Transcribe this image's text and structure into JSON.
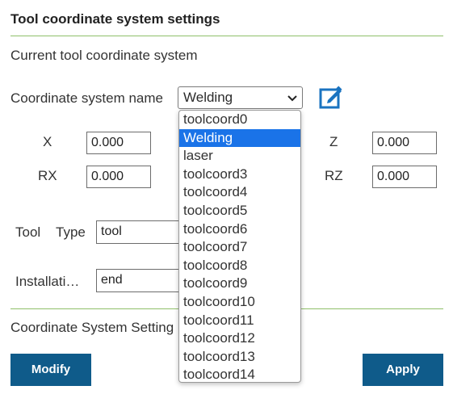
{
  "panel": {
    "title": "Tool coordinate system settings",
    "subtitle": "Current tool coordinate system",
    "coord_name_label": "Coordinate system name",
    "coord_selected": "Welding",
    "x_label": "X",
    "x_value": "0.000",
    "z_label": "Z",
    "z_value": "0.000",
    "rx_label": "RX",
    "rx_value": "0.000",
    "rz_label": "RZ",
    "rz_value": "0.000",
    "tool_label": "Tool",
    "type_label": "Type",
    "type_value": "tool",
    "install_label": "Installati…",
    "install_value": "end",
    "coord_settings_label": "Coordinate System Setting",
    "modify_label": "Modify",
    "apply_label": "Apply"
  },
  "dropdown": {
    "options": [
      "toolcoord0",
      "Welding",
      "laser",
      "toolcoord3",
      "toolcoord4",
      "toolcoord5",
      "toolcoord6",
      "toolcoord7",
      "toolcoord8",
      "toolcoord9",
      "toolcoord10",
      "toolcoord11",
      "toolcoord12",
      "toolcoord13",
      "toolcoord14"
    ],
    "selected_index": 1
  },
  "icons": {
    "edit": "edit-icon",
    "dropdown_arrow": "chevron-down-icon"
  },
  "colors": {
    "accent_line": "#8fbf6a",
    "button_bg": "#0f5b8a",
    "selection": "#1a73e8",
    "edit_icon": "#1a73c0"
  }
}
